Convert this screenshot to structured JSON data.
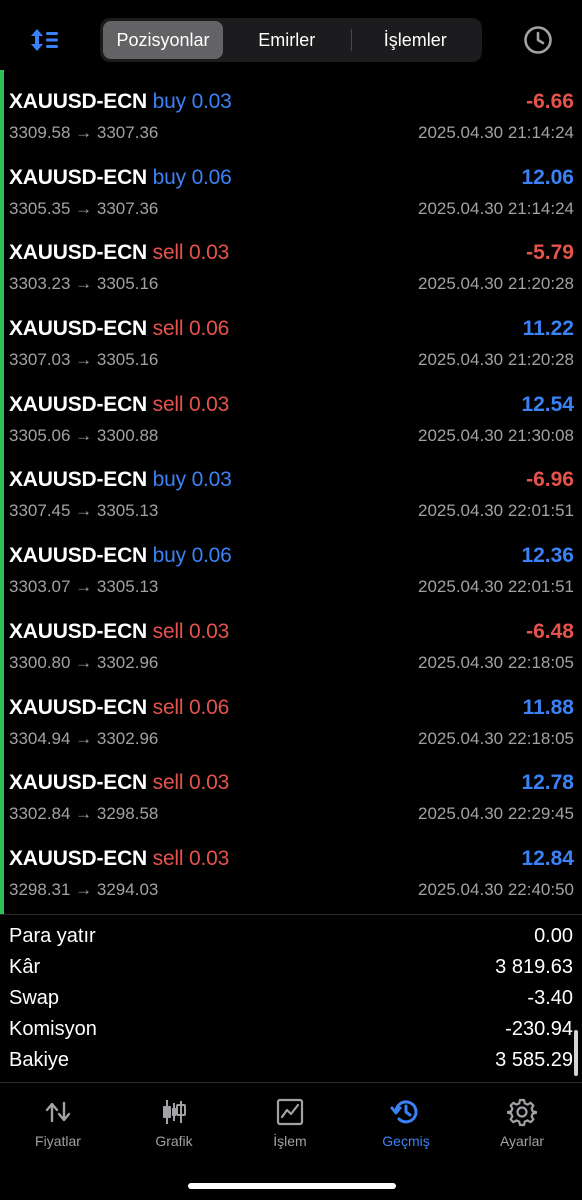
{
  "header": {
    "sort_icon": "sort-arrows-icon",
    "history_icon": "clock-icon",
    "tabs": [
      {
        "label": "Pozisyonlar",
        "active": true
      },
      {
        "label": "Emirler",
        "active": false
      },
      {
        "label": "İşlemler",
        "active": false
      }
    ]
  },
  "deals": [
    {
      "symbol": "XAUUSD-ECN",
      "side": "buy",
      "volume": "0.03",
      "prices": "3309.58 → 3307.36",
      "profit": "-6.66",
      "time": "2025.04.30 21:14:24"
    },
    {
      "symbol": "XAUUSD-ECN",
      "side": "buy",
      "volume": "0.06",
      "prices": "3305.35 → 3307.36",
      "profit": "12.06",
      "time": "2025.04.30 21:14:24"
    },
    {
      "symbol": "XAUUSD-ECN",
      "side": "sell",
      "volume": "0.03",
      "prices": "3303.23 → 3305.16",
      "profit": "-5.79",
      "time": "2025.04.30 21:20:28"
    },
    {
      "symbol": "XAUUSD-ECN",
      "side": "sell",
      "volume": "0.06",
      "prices": "3307.03 → 3305.16",
      "profit": "11.22",
      "time": "2025.04.30 21:20:28"
    },
    {
      "symbol": "XAUUSD-ECN",
      "side": "sell",
      "volume": "0.03",
      "prices": "3305.06 → 3300.88",
      "profit": "12.54",
      "time": "2025.04.30 21:30:08"
    },
    {
      "symbol": "XAUUSD-ECN",
      "side": "buy",
      "volume": "0.03",
      "prices": "3307.45 → 3305.13",
      "profit": "-6.96",
      "time": "2025.04.30 22:01:51"
    },
    {
      "symbol": "XAUUSD-ECN",
      "side": "buy",
      "volume": "0.06",
      "prices": "3303.07 → 3305.13",
      "profit": "12.36",
      "time": "2025.04.30 22:01:51"
    },
    {
      "symbol": "XAUUSD-ECN",
      "side": "sell",
      "volume": "0.03",
      "prices": "3300.80 → 3302.96",
      "profit": "-6.48",
      "time": "2025.04.30 22:18:05"
    },
    {
      "symbol": "XAUUSD-ECN",
      "side": "sell",
      "volume": "0.06",
      "prices": "3304.94 → 3302.96",
      "profit": "11.88",
      "time": "2025.04.30 22:18:05"
    },
    {
      "symbol": "XAUUSD-ECN",
      "side": "sell",
      "volume": "0.03",
      "prices": "3302.84 → 3298.58",
      "profit": "12.78",
      "time": "2025.04.30 22:29:45"
    },
    {
      "symbol": "XAUUSD-ECN",
      "side": "sell",
      "volume": "0.03",
      "prices": "3298.31 → 3294.03",
      "profit": "12.84",
      "time": "2025.04.30 22:40:50"
    }
  ],
  "summary": [
    {
      "label": "Para yatır",
      "value": "0.00"
    },
    {
      "label": "Kâr",
      "value": "3 819.63"
    },
    {
      "label": "Swap",
      "value": "-3.40"
    },
    {
      "label": "Komisyon",
      "value": "-230.94"
    },
    {
      "label": "Bakiye",
      "value": "3 585.29"
    }
  ],
  "tabbar": {
    "items": [
      {
        "label": "Fiyatlar",
        "icon": "quotes-arrows-icon",
        "active": false
      },
      {
        "label": "Grafik",
        "icon": "candlestick-chart-icon",
        "active": false
      },
      {
        "label": "İşlem",
        "icon": "trade-chart-icon",
        "active": false
      },
      {
        "label": "Geçmiş",
        "icon": "history-icon",
        "active": true
      },
      {
        "label": "Ayarlar",
        "icon": "gear-icon",
        "active": false
      }
    ]
  },
  "colors": {
    "accent": "#3b82f6",
    "loss": "#e5534b",
    "indicator": "#2fc05b",
    "muted": "#a1a1a6"
  }
}
